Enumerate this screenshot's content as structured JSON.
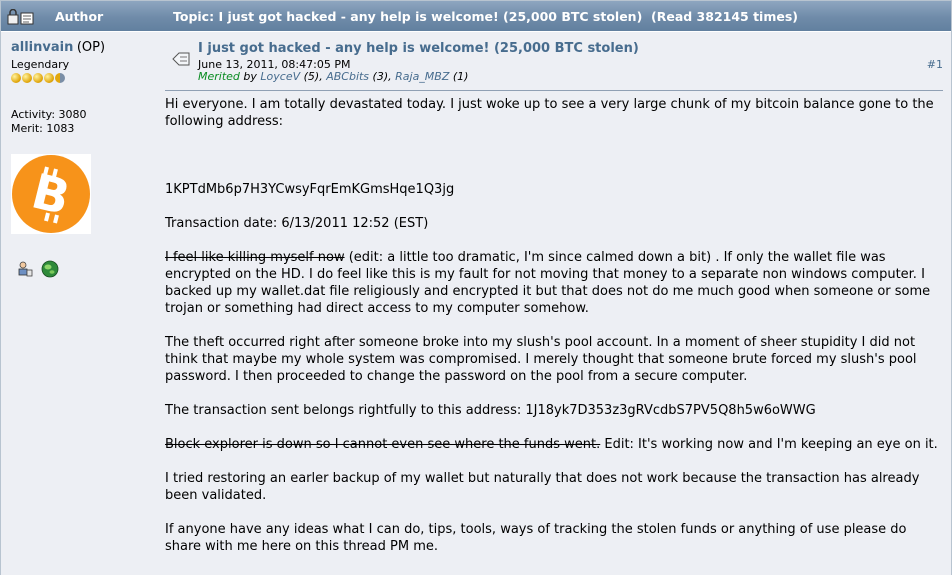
{
  "header": {
    "author_label": "Author",
    "topic_text": "Topic: I just got hacked - any help is welcome! (25,000 BTC stolen)  (Read 382145 times)"
  },
  "poster": {
    "name": "allinvain",
    "op_tag": "(OP)",
    "rank": "Legendary",
    "activity": "Activity: 3080",
    "merit": "Merit: 1083"
  },
  "post": {
    "title": "I just got hacked - any help is welcome! (25,000 BTC stolen)",
    "date": "June 13, 2011, 08:47:05 PM",
    "merited_label": "Merited",
    "by_label": "by",
    "merits": [
      {
        "user": "LoyceV",
        "count": "(5),"
      },
      {
        "user": "ABCbits",
        "count": "(3),"
      },
      {
        "user": "Raja_MBZ",
        "count": "(1)"
      }
    ],
    "number": "#1",
    "paragraphs": {
      "p1": "Hi everyone. I am totally devastated today. I just woke up to see a very large chunk of my bitcoin balance gone to the following address:",
      "p2": "1KPTdMb6p7H3YCwsyFqrEmKGmsHqe1Q3jg",
      "p3": "Transaction date: 6/13/2011 12:52 (EST)",
      "p4_strike": "I feel like killing myself now",
      "p4_rest": " (edit: a little too dramatic, I'm since calmed down a bit) . If only the wallet file was encrypted on the HD. I do feel like this is my fault for not moving that money to a separate non windows computer. I backed up my wallet.dat file religiously and encrypted it but that does not do me much good when someone or some trojan or something had direct access to my computer somehow.",
      "p5": "The theft occurred right after someone broke into my slush's pool account. In a moment of sheer stupidity I did not think that maybe my whole system was compromised. I merely thought that someone brute forced my slush's pool password. I then proceeded to change the password on the pool from a secure computer.",
      "p6": "The transaction sent belongs rightfully to this address: 1J18yk7D353z3gRVcdbS7PV5Q8h5w6oWWG",
      "p7_strike": "Block explorer is down so I cannot even see where the funds went.",
      "p7_rest": " Edit: It's working now and I'm keeping an eye on it.",
      "p8": "I tried restoring an earler backup of my wallet but naturally that does not work because the transaction has already been validated.",
      "p9": "If anyone have any ideas what I can do, tips, tools, ways of tracking the stolen funds or anything of use please do share with me here on this thread PM me."
    }
  },
  "colors": {
    "header_bg": "#6f8ba9",
    "post_bg": "#edeff4",
    "link": "#476c8e",
    "merit_green": "#0a8c22",
    "bitcoin_orange": "#f7931a"
  },
  "icons": [
    "lock-icon",
    "post-icon",
    "bitcoin-avatar",
    "profile-icon",
    "website-globe-icon"
  ]
}
